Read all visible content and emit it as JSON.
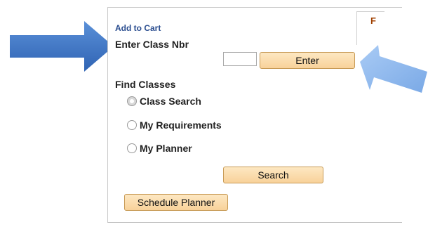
{
  "add_to_cart": {
    "link_label": "Add to Cart",
    "class_nbr_label": "Enter Class Nbr",
    "class_nbr_value": "",
    "enter_button_label": "Enter"
  },
  "find_classes": {
    "heading": "Find Classes",
    "options": [
      {
        "label": "Class Search",
        "selected": true
      },
      {
        "label": "My Requirements",
        "selected": false
      },
      {
        "label": "My Planner",
        "selected": false
      }
    ],
    "search_button_label": "Search"
  },
  "schedule_planner_button_label": "Schedule Planner",
  "side_panel": {
    "partial_label": "F"
  },
  "colors": {
    "button_fill": "#f8d29a",
    "button_border": "#c79a55",
    "link": "#2a4d8f",
    "left_arrow": "#3f79c8",
    "right_arrow": "#8cb7ee"
  },
  "icons": {
    "left_arrow": "arrow-right-icon",
    "right_arrow": "arrow-pointing-enter-icon"
  }
}
